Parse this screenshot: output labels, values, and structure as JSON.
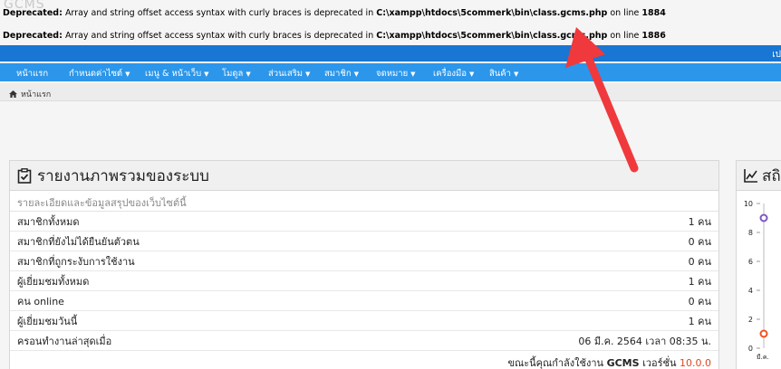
{
  "ghost_logo": "GCMS",
  "warnings": [
    {
      "label": "Deprecated",
      "message": "Array and string offset access syntax with curly braces is deprecated in",
      "path": "C:\\xampp\\htdocs\\5commerk\\bin\\class.gcms.php",
      "on_line": "on line",
      "line": "1884"
    },
    {
      "label": "Deprecated",
      "message": "Array and string offset access syntax with curly braces is deprecated in",
      "path": "C:\\xampp\\htdocs\\5commerk\\bin\\class.gcms.php",
      "on_line": "on line",
      "line": "1886"
    }
  ],
  "topbar": {
    "right_text": "เป"
  },
  "nav": {
    "items": [
      {
        "label": "หน้าแรก",
        "has_caret": false
      },
      {
        "label": "กำหนดค่าไซต์",
        "has_caret": true
      },
      {
        "label": "เมนู & หน้าเว็บ",
        "has_caret": true
      },
      {
        "label": "โมดูล",
        "has_caret": true
      },
      {
        "label": "ส่วนเสริม",
        "has_caret": true
      },
      {
        "label": "สมาชิก",
        "has_caret": true
      },
      {
        "label": "จดหมาย",
        "has_caret": true
      },
      {
        "label": "เครื่องมือ",
        "has_caret": true
      },
      {
        "label": "สินค้า",
        "has_caret": true
      }
    ]
  },
  "breadcrumb": {
    "home": "หน้าแรก"
  },
  "overview": {
    "title": "รายงานภาพรวมของระบบ",
    "subtitle": "รายละเอียดและข้อมูลสรุปของเว็บไซต์นี้",
    "rows": [
      {
        "label": "สมาชิกทั้งหมด",
        "value": "1 คน"
      },
      {
        "label": "สมาชิกที่ยังไม่ได้ยืนยันตัวตน",
        "value": "0 คน"
      },
      {
        "label": "สมาชิกที่ถูกระงับการใช้งาน",
        "value": "0 คน"
      },
      {
        "label": "ผู้เยี่ยมชมทั้งหมด",
        "value": "1 คน"
      },
      {
        "label": "คน online",
        "value": "0 คน"
      },
      {
        "label": "ผู้เยี่ยมชมวันนี้",
        "value": "1 คน"
      },
      {
        "label": "ครอนทำงานล่าสุดเมื่อ",
        "value": "06 มี.ค. 2564 เวลา 08:35 น."
      }
    ],
    "footer_prefix": "ขณะนี้คุณกำลังใช้งาน",
    "brand": "GCMS",
    "version_label": "เวอร์ชั่น",
    "version": "10.0.0"
  },
  "stats_panel": {
    "title": "สถิ",
    "chart_data": {
      "type": "line",
      "title": "",
      "yticks": [
        "10",
        "8",
        "6",
        "4",
        "2",
        "0"
      ],
      "ylim": [
        0,
        10
      ],
      "x": [
        "มี.ค."
      ],
      "series": [
        {
          "values": [
            9
          ],
          "color": "#7e57c2"
        },
        {
          "values": [
            1
          ],
          "color": "#f4511e"
        }
      ]
    }
  },
  "colors": {
    "nav": "#2b96ea",
    "topbar": "#1976d2",
    "arrow": "#f0393c",
    "version": "#e0461d"
  }
}
